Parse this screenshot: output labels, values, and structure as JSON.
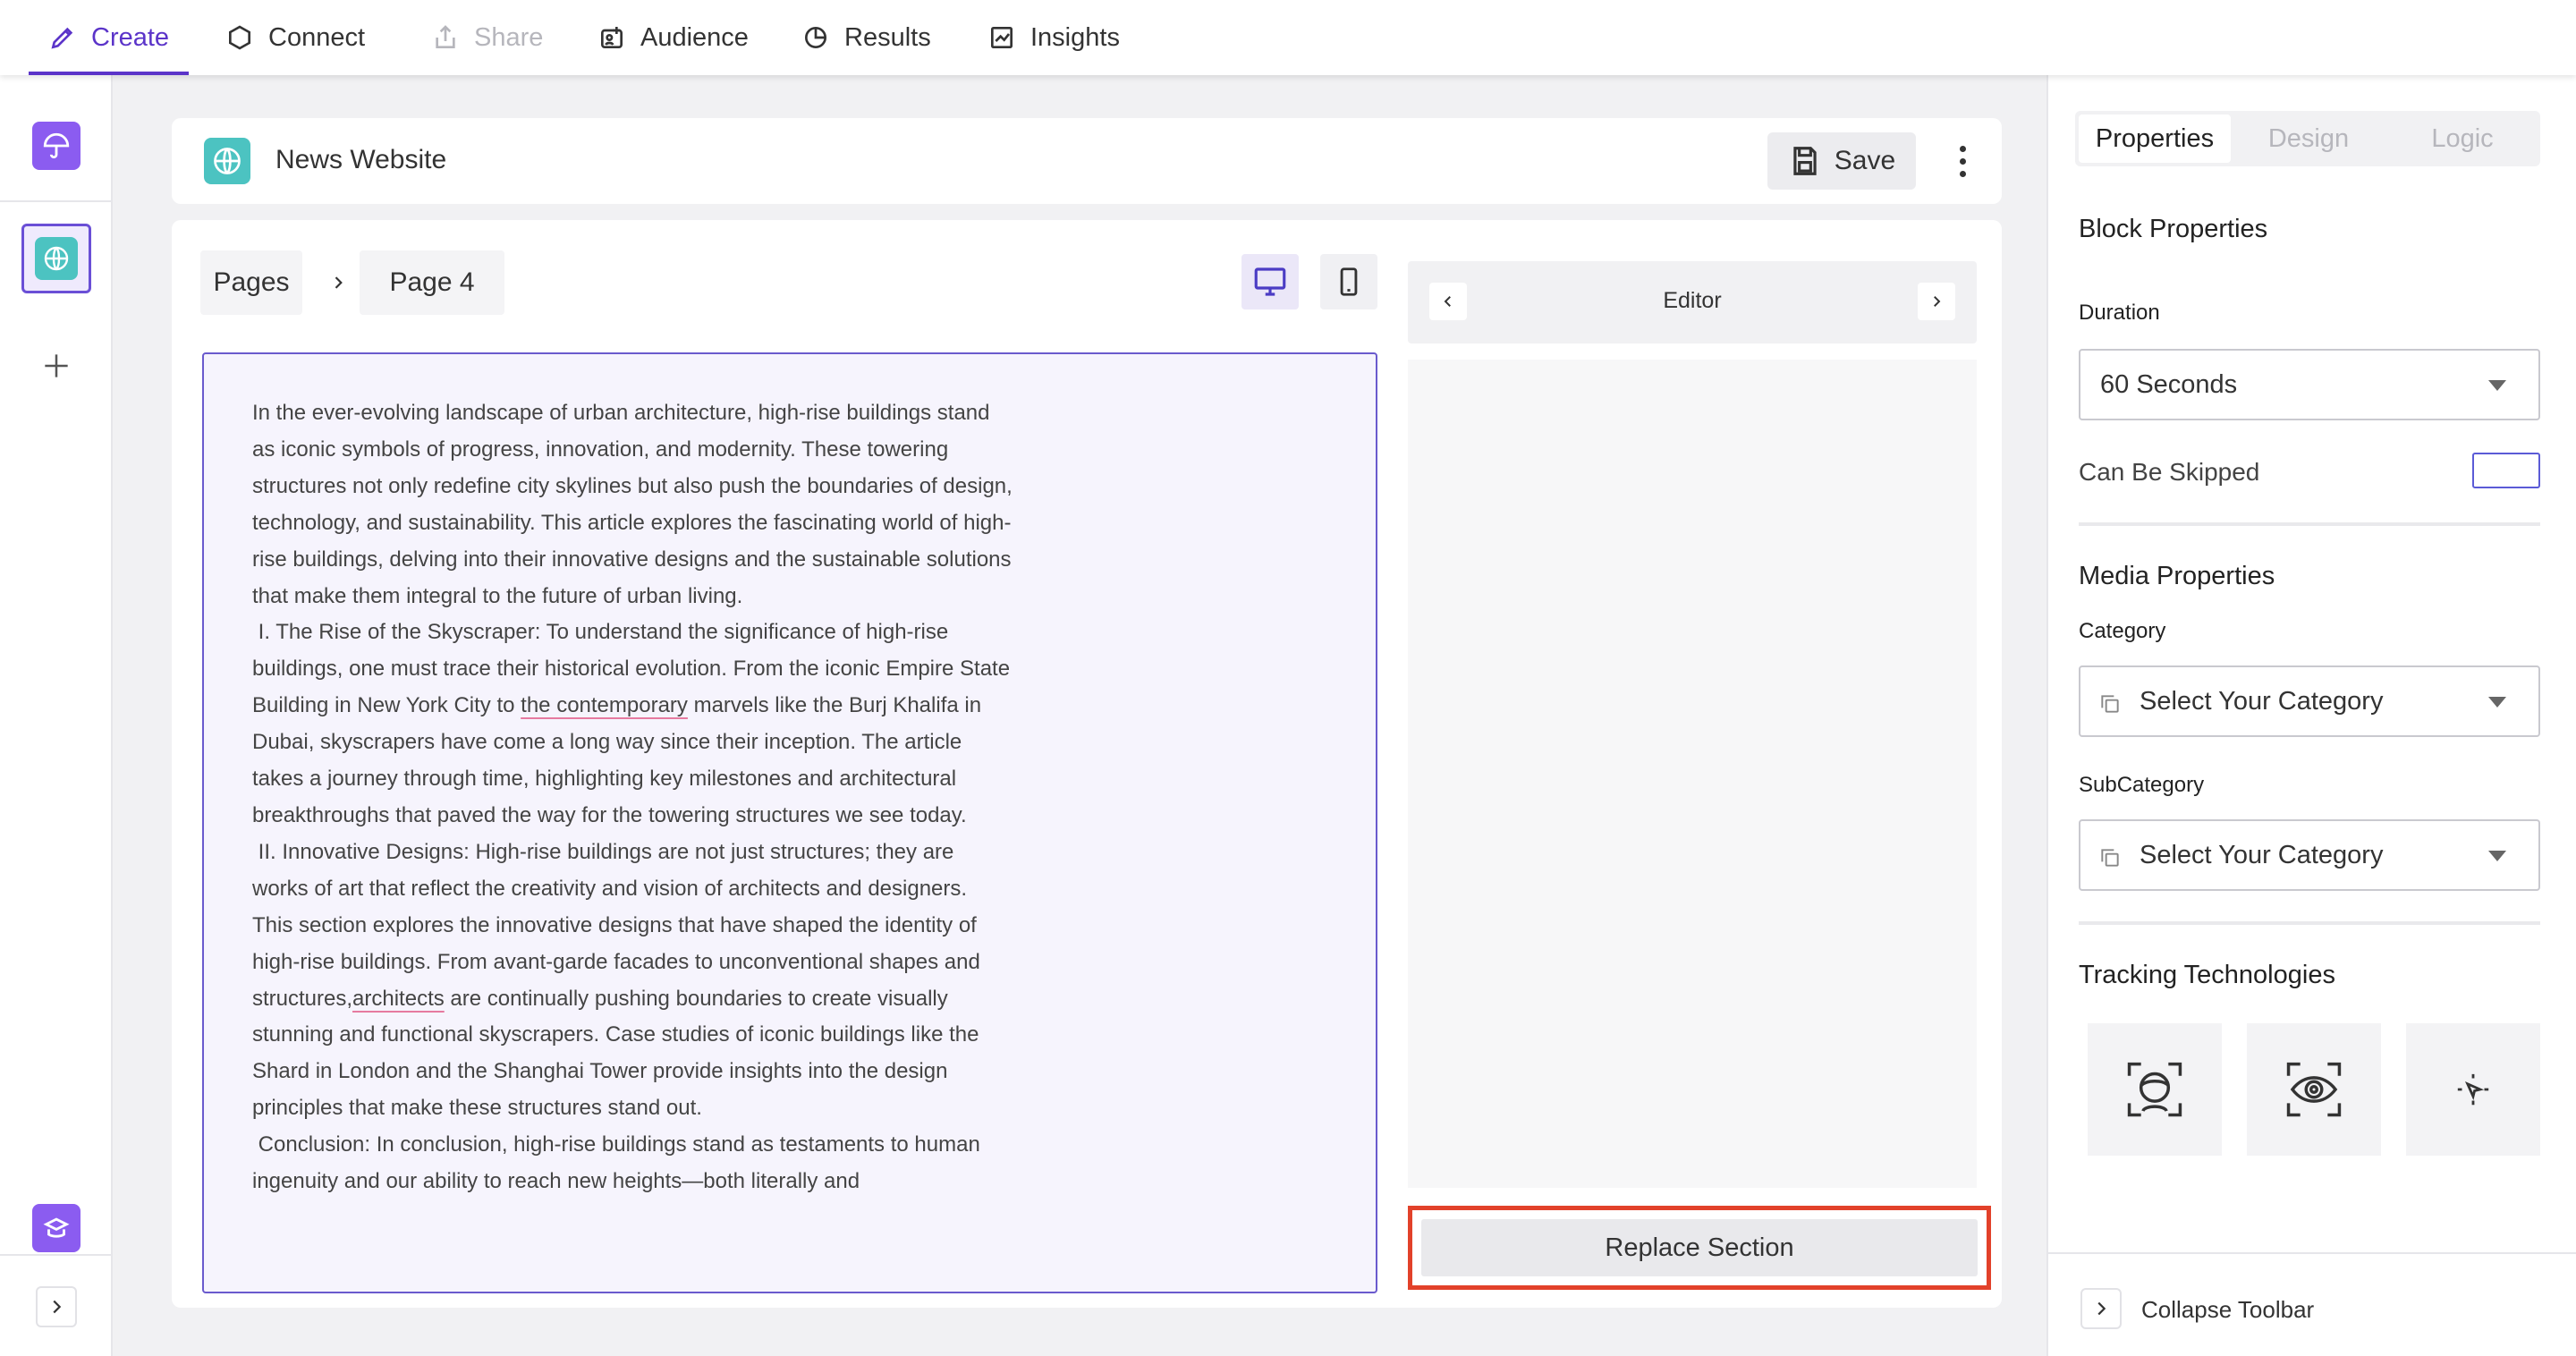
{
  "nav": {
    "items": [
      {
        "label": "Create",
        "icon": "pencil-icon",
        "state": "active"
      },
      {
        "label": "Connect",
        "icon": "hexagon-icon",
        "state": "normal"
      },
      {
        "label": "Share",
        "icon": "share-icon",
        "state": "disabled"
      },
      {
        "label": "Audience",
        "icon": "audience-icon",
        "state": "normal"
      },
      {
        "label": "Results",
        "icon": "pie-chart-icon",
        "state": "normal"
      },
      {
        "label": "Insights",
        "icon": "line-chart-icon",
        "state": "normal"
      }
    ]
  },
  "header": {
    "site_title": "News Website",
    "save_label": "Save"
  },
  "breadcrumb": {
    "root": "Pages",
    "current": "Page 4"
  },
  "article": {
    "p1": "In the ever-evolving landscape of urban architecture, high-rise buildings stand as iconic symbols of progress, innovation, and modernity. These towering structures not only redefine city skylines but also push the boundaries of design, technology, and sustainability. This article explores the fascinating world of high-rise buildings, delving into their innovative designs and the sustainable solutions that make them integral to the future of urban living.",
    "p2_a": " I. The Rise of the Skyscraper: To understand the significance of high-rise buildings, one must trace their historical evolution. From the iconic Empire State Building in New York City to ",
    "p2_flag": "the contemporary",
    "p2_b": " marvels like the Burj Khalifa in Dubai, skyscrapers have come a long way since their inception. The article takes a journey through time, highlighting key milestones and architectural breakthroughs that paved the way for the towering structures we see today.",
    "p3_a": " II. Innovative Designs: High-rise buildings are not just structures; they are works of art that reflect the creativity and vision of architects and designers. This section explores the innovative designs that have shaped the identity of high-rise buildings. From avant-garde facades to unconventional shapes and structures,",
    "p3_flag": "architects",
    "p3_b": " are continually pushing boundaries to create visually stunning and functional skyscrapers. Case studies of iconic buildings like the Shard in London and the Shanghai Tower provide insights into the design principles that make these structures stand out.",
    "p4": " Conclusion: In conclusion, high-rise buildings stand as testaments to human ingenuity and our ability to reach new heights—both literally and"
  },
  "editor": {
    "label": "Editor",
    "replace_label": "Replace Section"
  },
  "panel": {
    "tabs": [
      "Properties",
      "Design",
      "Logic"
    ],
    "block_title": "Block Properties",
    "duration_label": "Duration",
    "duration_value": "60 Seconds",
    "skip_label": "Can Be Skipped",
    "media_title": "Media Properties",
    "category_label": "Category",
    "category_placeholder": "Select Your Category",
    "subcategory_label": "SubCategory",
    "subcategory_placeholder": "Select Your Category",
    "tracking_title": "Tracking Technologies",
    "collapse_label": "Collapse Toolbar"
  },
  "colors": {
    "accent": "#5b34c9",
    "highlight_border": "#e2412a",
    "site_icon": "#4cc3c1"
  }
}
